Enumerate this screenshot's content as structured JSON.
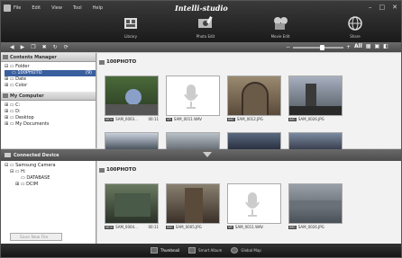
{
  "menu": [
    "File",
    "Edit",
    "View",
    "Tool",
    "Help"
  ],
  "app_title": "Intelli-studio",
  "modes": [
    {
      "label": "Library",
      "icon": "library-icon"
    },
    {
      "label": "Photo Edit",
      "icon": "photo-edit-icon"
    },
    {
      "label": "Movie Edit",
      "icon": "movie-edit-icon"
    },
    {
      "label": "Share",
      "icon": "globe-icon"
    }
  ],
  "view_label": "All",
  "contents_manager": {
    "title": "Contents Manager",
    "items": [
      {
        "label": "Folder"
      },
      {
        "label": "100PHOTO",
        "count": "(9)"
      },
      {
        "label": "Date"
      },
      {
        "label": "Color"
      }
    ]
  },
  "my_computer": {
    "title": "My Computer",
    "items": [
      "C:",
      "D:",
      "Desktop",
      "My Documents"
    ]
  },
  "top_folder": "100PHOTO",
  "top_thumbs": [
    {
      "type": "movie",
      "name": "SAM_0003...",
      "duration": "00:11",
      "badge": "MOV"
    },
    {
      "type": "audio",
      "name": "SAM_0011.WAV",
      "badge": "VR"
    },
    {
      "type": "photo",
      "name": "SAM_0012.JPG",
      "badge": "IMG"
    },
    {
      "type": "photo",
      "name": "SAM_0026.JPG",
      "badge": "IMG"
    }
  ],
  "connected_device": {
    "title": "Connected Device",
    "items": [
      "Samsung Camera",
      "H:",
      "DATABASE",
      "DCIM"
    ],
    "save_button": "Save New File"
  },
  "bottom_folder": "100PHOTO",
  "bottom_thumbs": [
    {
      "type": "movie",
      "name": "SAM_0004...",
      "duration": "00:11",
      "badge": "MOV"
    },
    {
      "type": "photo",
      "name": "SAM_0005.JPG",
      "badge": "IMG"
    },
    {
      "type": "audio",
      "name": "SAM_0011.WAV",
      "badge": "VR"
    },
    {
      "type": "photo",
      "name": "SAM_0026.JPG",
      "badge": "IMG"
    }
  ],
  "bottom_tabs": [
    {
      "label": "Thumbnail",
      "active": true
    },
    {
      "label": "Smart Album",
      "active": false
    },
    {
      "label": "Global Map",
      "active": false
    }
  ]
}
